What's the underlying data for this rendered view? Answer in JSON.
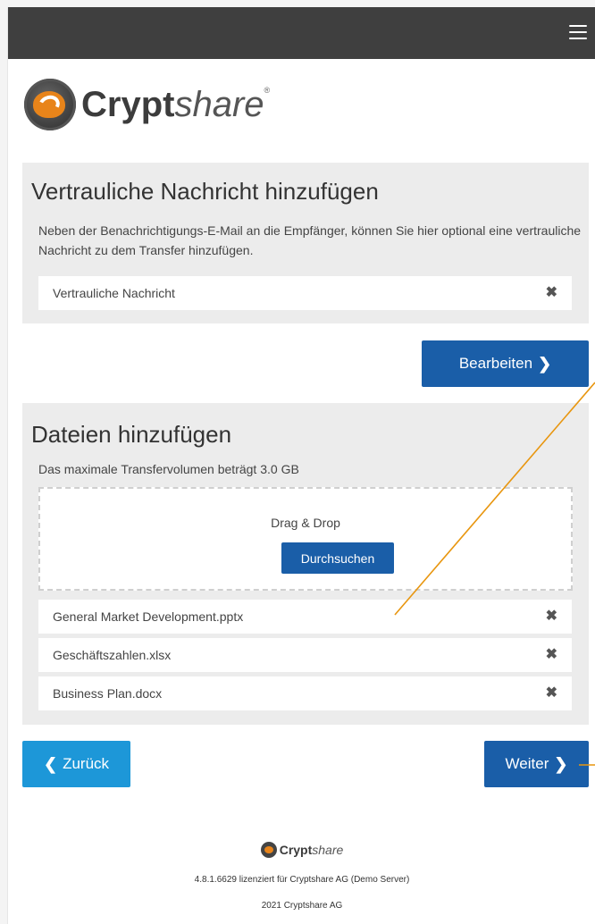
{
  "topbar": {
    "menu_icon": "hamburger-menu-icon"
  },
  "logo": {
    "bold": "Crypt",
    "light": "share",
    "reg": "®"
  },
  "message_section": {
    "title": "Vertrauliche Nachricht hinzufügen",
    "description": "Neben der Benachrichtigungs-E-Mail an die Empfänger, können Sie hier optional eine vertrauliche Nachricht zu dem Transfer hinzufügen.",
    "item_label": "Vertrauliche Nachricht",
    "remove_symbol": "✖"
  },
  "edit_button": {
    "label": "Bearbeiten",
    "chevron": "❯"
  },
  "files_section": {
    "title": "Dateien hinzufügen",
    "limit_text": "Das maximale Transfervolumen beträgt 3.0 GB",
    "drop_label": "Drag & Drop",
    "browse_label": "Durchsuchen",
    "remove_symbol": "✖",
    "files": [
      {
        "name": "General Market Development.pptx"
      },
      {
        "name": "Geschäftszahlen.xlsx"
      },
      {
        "name": "Business Plan.docx"
      }
    ]
  },
  "nav": {
    "back_label": "Zurück",
    "back_chevron": "❮",
    "next_label": "Weiter",
    "next_chevron": "❯"
  },
  "footer": {
    "logo_bold": "Crypt",
    "logo_light": "share",
    "license": "4.8.1.6629 lizenziert für Cryptshare AG (Demo Server)",
    "copyright": "2021 Cryptshare AG"
  },
  "colors": {
    "topbar": "#3f3f3f",
    "primary_button": "#1a5ea8",
    "back_button": "#1d97d8",
    "panel": "#ececec",
    "annotation_line": "#e8960f"
  }
}
